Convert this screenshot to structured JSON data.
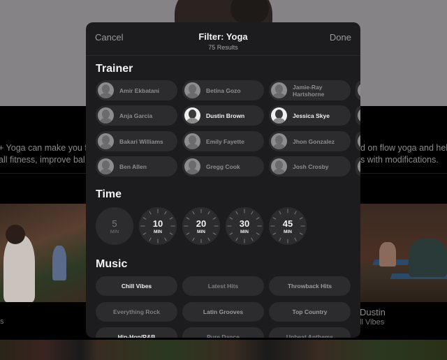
{
  "background": {
    "description_left": [
      "+ Yoga can make you f",
      "all fitness, improve bal"
    ],
    "description_right": [
      "d on flow yoga and help",
      "s with modifications."
    ],
    "card_right_trainer": "Dustin",
    "card_right_music": "ll Vibes",
    "card_left_music": "s"
  },
  "modal": {
    "cancel_label": "Cancel",
    "title": "Filter: Yoga",
    "subtitle": "75 Results",
    "done_label": "Done"
  },
  "trainer": {
    "title": "Trainer",
    "items": [
      {
        "name": "Amir Ekbatani",
        "selected": false
      },
      {
        "name": "Betina Gozo",
        "selected": false
      },
      {
        "name": "Jamie-Ray Hartshorne",
        "selected": false
      },
      {
        "name": "Anja Garcia",
        "selected": false
      },
      {
        "name": "Dustin Brown",
        "selected": true
      },
      {
        "name": "Jessica Skye",
        "selected": true
      },
      {
        "name": "Bakari Williams",
        "selected": false
      },
      {
        "name": "Emily Fayette",
        "selected": false
      },
      {
        "name": "Jhon Gonzalez",
        "selected": false
      },
      {
        "name": "Ben Allen",
        "selected": false
      },
      {
        "name": "Gregg Cook",
        "selected": false
      },
      {
        "name": "Josh Crosby",
        "selected": false
      }
    ]
  },
  "time": {
    "title": "Time",
    "items": [
      {
        "value": "5",
        "unit": "MIN",
        "enabled": false
      },
      {
        "value": "10",
        "unit": "MIN",
        "enabled": true
      },
      {
        "value": "20",
        "unit": "MIN",
        "enabled": true
      },
      {
        "value": "30",
        "unit": "MIN",
        "enabled": true
      },
      {
        "value": "45",
        "unit": "MIN",
        "enabled": true
      }
    ]
  },
  "music": {
    "title": "Music",
    "items": [
      {
        "label": "Chill Vibes",
        "state": "selected"
      },
      {
        "label": "Latest Hits",
        "state": "dim"
      },
      {
        "label": "Throwback Hits",
        "state": "mid"
      },
      {
        "label": "Everything Rock",
        "state": "dim"
      },
      {
        "label": "Latin Grooves",
        "state": "mid"
      },
      {
        "label": "Top Country",
        "state": "mid"
      },
      {
        "label": "Hip-Hop/R&B",
        "state": "selected"
      },
      {
        "label": "Pure Dance",
        "state": "dim"
      },
      {
        "label": "Upbeat Anthems",
        "state": "dim"
      }
    ]
  }
}
